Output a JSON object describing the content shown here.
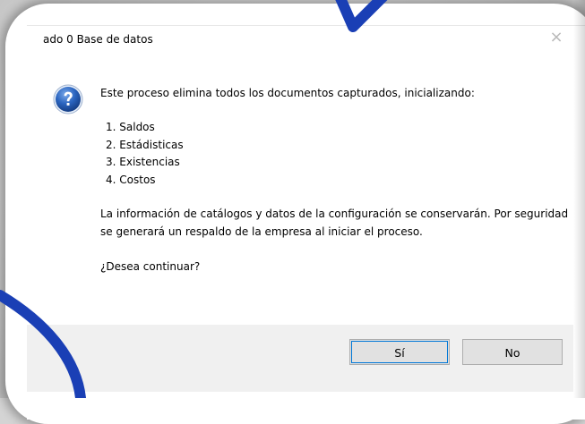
{
  "dialog": {
    "title": "ado 0 Base de datos",
    "message": "Este proceso elimina todos los documentos capturados, inicializando:",
    "items": [
      "1. Saldos",
      "2. Estádisticas",
      "3. Existencias",
      "4. Costos"
    ],
    "info": "La información de catálogos y datos de la configuración se conservarán. Por seguridad se generará un respaldo de la empresa al iniciar el proceso.",
    "question": "¿Desea continuar?",
    "yes_label": "Sí",
    "no_label": "No",
    "close_glyph": "×"
  },
  "icons": {
    "question": "question-mark-icon",
    "close": "close-icon"
  },
  "colors": {
    "annotation": "#1a3fb5",
    "focus": "#0078d7",
    "icon_blue": "#1f56a8"
  }
}
